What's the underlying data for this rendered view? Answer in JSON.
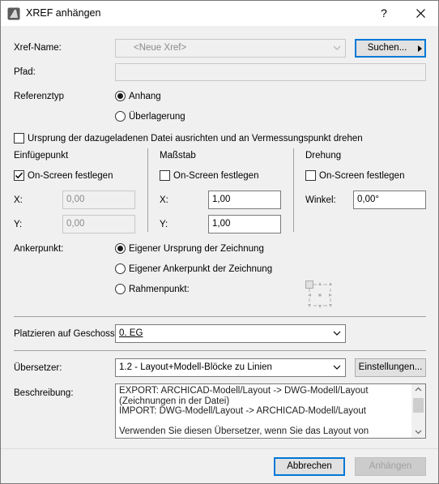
{
  "window": {
    "title": "XREF anhängen",
    "help_label": "?",
    "close_label": "✕"
  },
  "xref": {
    "name_label": "Xref-Name:",
    "name_placeholder": "<Neue Xref>",
    "search_button": "Suchen...",
    "path_label": "Pfad:",
    "path_value": ""
  },
  "ref_type": {
    "label": "Referenztyp",
    "options": [
      "Anhang",
      "Überlagerung"
    ],
    "selected": 0
  },
  "align_checkbox": {
    "label": "Ursprung der dazugeladenen Datei ausrichten und an Vermessungspunkt drehen",
    "checked": false
  },
  "insert_point": {
    "label": "Einfügepunkt",
    "onscreen_label": "On-Screen festlegen",
    "onscreen_checked": true,
    "x_label": "X:",
    "x_value": "0,00",
    "y_label": "Y:",
    "y_value": "0,00"
  },
  "scale": {
    "label": "Maßstab",
    "onscreen_label": "On-Screen festlegen",
    "onscreen_checked": false,
    "x_label": "X:",
    "x_value": "1,00",
    "y_label": "Y:",
    "y_value": "1,00"
  },
  "rotation": {
    "label": "Drehung",
    "onscreen_label": "On-Screen festlegen",
    "onscreen_checked": false,
    "angle_label": "Winkel:",
    "angle_value": "0,00°"
  },
  "anchor": {
    "label": "Ankerpunkt:",
    "options": [
      "Eigener Ursprung der Zeichnung",
      "Eigener Ankerpunkt der Zeichnung",
      "Rahmenpunkt:"
    ],
    "selected": 0
  },
  "story": {
    "label": "Platzieren auf Geschoss",
    "value": "0. EG"
  },
  "translator": {
    "label": "Übersetzer:",
    "value": "1.2 - Layout+Modell-Blöcke zu Linien",
    "settings_button": "Einstellungen..."
  },
  "description": {
    "label": "Beschreibung:",
    "lines": [
      "EXPORT: ARCHICAD-Modell/Layout -> DWG-Modell/Layout",
      "(Zeichnungen in der Datei)",
      "IMPORT: DWG-Modell/Layout -> ARCHICAD-Modell/Layout",
      "",
      "Verwenden Sie diesen Übersetzer, wenn Sie das Layout von"
    ]
  },
  "footer": {
    "cancel_button": "Abbrechen",
    "attach_button": "Anhängen"
  },
  "colors": {
    "accent": "#0078d7",
    "dialog_bg": "#f0f0f0"
  }
}
